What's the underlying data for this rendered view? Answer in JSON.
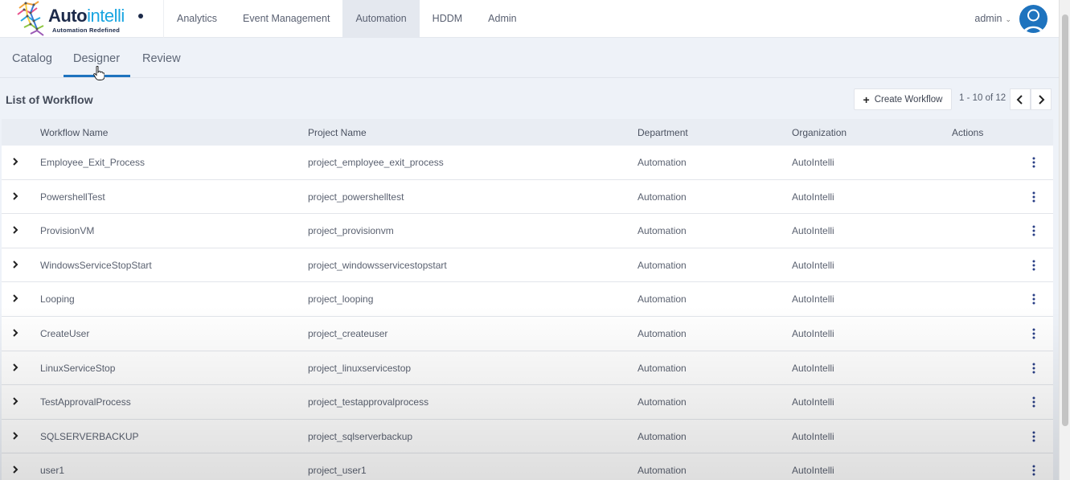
{
  "brand": {
    "name_bold": "Auto",
    "name_light": "intelli",
    "tagline": "Automation Redefined"
  },
  "nav": {
    "items": [
      {
        "label": "Analytics",
        "active": false
      },
      {
        "label": "Event Management",
        "active": false
      },
      {
        "label": "Automation",
        "active": true
      },
      {
        "label": "HDDM",
        "active": false
      },
      {
        "label": "Admin",
        "active": false
      }
    ],
    "user": "admin"
  },
  "subtabs": [
    {
      "label": "Catalog",
      "active": false
    },
    {
      "label": "Designer",
      "active": true
    },
    {
      "label": "Review",
      "active": false
    }
  ],
  "list": {
    "title": "List of Workflow",
    "create_label": "Create Workflow",
    "pagination": "1 - 10 of 12"
  },
  "table": {
    "columns": [
      "Workflow Name",
      "Project Name",
      "Department",
      "Organization",
      "Actions"
    ],
    "rows": [
      {
        "workflow": "Employee_Exit_Process",
        "project": "project_employee_exit_process",
        "department": "Automation",
        "organization": "AutoIntelli"
      },
      {
        "workflow": "PowershellTest",
        "project": "project_powershelltest",
        "department": "Automation",
        "organization": "AutoIntelli"
      },
      {
        "workflow": "ProvisionVM",
        "project": "project_provisionvm",
        "department": "Automation",
        "organization": "AutoIntelli"
      },
      {
        "workflow": "WindowsServiceStopStart",
        "project": "project_windowsservicestopstart",
        "department": "Automation",
        "organization": "AutoIntelli"
      },
      {
        "workflow": "Looping",
        "project": "project_looping",
        "department": "Automation",
        "organization": "AutoIntelli"
      },
      {
        "workflow": "CreateUser",
        "project": "project_createuser",
        "department": "Automation",
        "organization": "AutoIntelli"
      },
      {
        "workflow": "LinuxServiceStop",
        "project": "project_linuxservicestop",
        "department": "Automation",
        "organization": "AutoIntelli"
      },
      {
        "workflow": "TestApprovalProcess",
        "project": "project_testapprovalprocess",
        "department": "Automation",
        "organization": "AutoIntelli"
      },
      {
        "workflow": "SQLSERVERBACKUP",
        "project": "project_sqlserverbackup",
        "department": "Automation",
        "organization": "AutoIntelli"
      },
      {
        "workflow": "user1",
        "project": "project_user1",
        "department": "Automation",
        "organization": "AutoIntelli"
      }
    ]
  },
  "colors": {
    "accent": "#1e73be",
    "brand_light": "#19a5e1",
    "brand_dark": "#1c2a4a",
    "kebab": "#2a3f86"
  }
}
